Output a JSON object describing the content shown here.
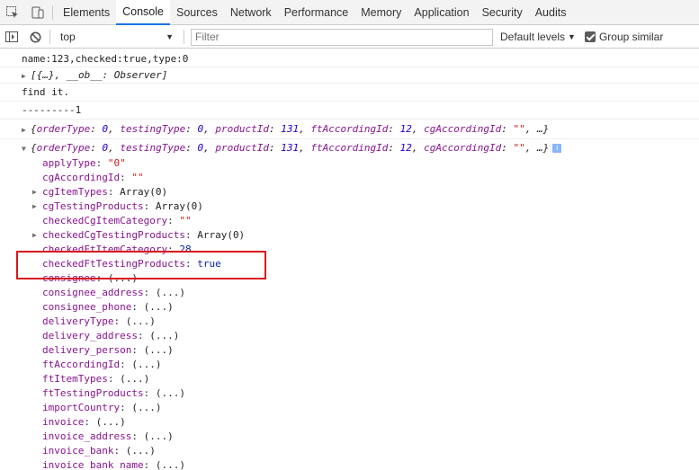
{
  "tabs": [
    "Elements",
    "Console",
    "Sources",
    "Network",
    "Performance",
    "Memory",
    "Application",
    "Security",
    "Audits"
  ],
  "active_tab": "Console",
  "toolbar": {
    "context": "top",
    "filter_placeholder": "Filter",
    "levels_label": "Default levels",
    "group_similar_label": "Group similar",
    "group_similar_checked": true
  },
  "console": {
    "line1": "name:123,checked:true,type:0",
    "line2_text": "[{…}, __ob__: Observer]",
    "line3": "find it.",
    "line4": "---------1",
    "obj_preview": {
      "k1": "orderType",
      "v1": "0",
      "k2": "testingType",
      "v2": "0",
      "k3": "productId",
      "v3": "131",
      "k4": "ftAccordingId",
      "v4": "12",
      "k5": "cgAccordingId",
      "v5": "\"\"",
      "tail": ", …}"
    }
  },
  "properties": [
    {
      "key": "applyType",
      "value": "\"0\"",
      "kind": "string",
      "expandable": false
    },
    {
      "key": "cgAccordingId",
      "value": "\"\"",
      "kind": "string",
      "expandable": false
    },
    {
      "key": "cgItemTypes",
      "value": "Array(0)",
      "kind": "plain",
      "expandable": true
    },
    {
      "key": "cgTestingProducts",
      "value": "Array(0)",
      "kind": "plain",
      "expandable": true
    },
    {
      "key": "checkedCgItemCategory",
      "value": "\"\"",
      "kind": "string",
      "expandable": false
    },
    {
      "key": "checkedCgTestingProducts",
      "value": "Array(0)",
      "kind": "plain",
      "expandable": true
    },
    {
      "key": "checkedFtItemCategory",
      "value": "28",
      "kind": "number",
      "expandable": false
    },
    {
      "key": "checkedFtTestingProducts",
      "value": "true",
      "kind": "bool",
      "expandable": false
    },
    {
      "key": "consignee",
      "value": "(...)",
      "kind": "plain",
      "expandable": false
    },
    {
      "key": "consignee_address",
      "value": "(...)",
      "kind": "plain",
      "expandable": false
    },
    {
      "key": "consignee_phone",
      "value": "(...)",
      "kind": "plain",
      "expandable": false
    },
    {
      "key": "deliveryType",
      "value": "(...)",
      "kind": "plain",
      "expandable": false
    },
    {
      "key": "delivery_address",
      "value": "(...)",
      "kind": "plain",
      "expandable": false
    },
    {
      "key": "delivery_person",
      "value": "(...)",
      "kind": "plain",
      "expandable": false
    },
    {
      "key": "ftAccordingId",
      "value": "(...)",
      "kind": "plain",
      "expandable": false
    },
    {
      "key": "ftItemTypes",
      "value": "(...)",
      "kind": "plain",
      "expandable": false
    },
    {
      "key": "ftTestingProducts",
      "value": "(...)",
      "kind": "plain",
      "expandable": false
    },
    {
      "key": "importCountry",
      "value": "(...)",
      "kind": "plain",
      "expandable": false
    },
    {
      "key": "invoice",
      "value": "(...)",
      "kind": "plain",
      "expandable": false
    },
    {
      "key": "invoice_address",
      "value": "(...)",
      "kind": "plain",
      "expandable": false
    },
    {
      "key": "invoice_bank",
      "value": "(...)",
      "kind": "plain",
      "expandable": false
    },
    {
      "key": "invoice_bank_name",
      "value": "(...)",
      "kind": "plain",
      "expandable": false
    }
  ],
  "colors": {
    "highlight_border": "#d9161d",
    "active_tab_underline": "#1a73e8",
    "property_key": "#881391",
    "string_value": "#c41a16",
    "number_value": "#1c00cf"
  }
}
